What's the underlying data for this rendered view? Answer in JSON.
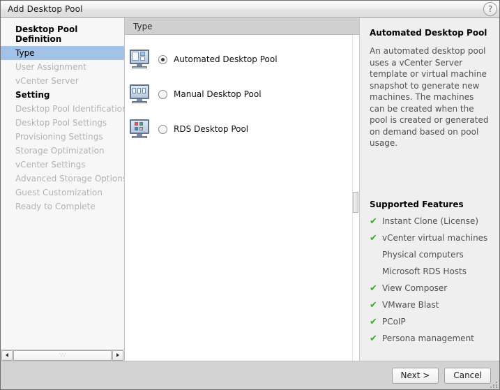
{
  "window": {
    "title": "Add Desktop Pool",
    "help_icon": "?"
  },
  "sidebar": {
    "groups": [
      {
        "label": "Desktop Pool Definition",
        "items": [
          {
            "label": "Type",
            "state": "active"
          },
          {
            "label": "User Assignment",
            "state": "disabled"
          },
          {
            "label": "vCenter Server",
            "state": "disabled"
          }
        ]
      },
      {
        "label": "Setting",
        "items": [
          {
            "label": "Desktop Pool Identification",
            "state": "disabled"
          },
          {
            "label": "Desktop Pool Settings",
            "state": "disabled"
          },
          {
            "label": "Provisioning Settings",
            "state": "disabled"
          },
          {
            "label": "Storage Optimization",
            "state": "disabled"
          },
          {
            "label": "vCenter Settings",
            "state": "disabled"
          },
          {
            "label": "Advanced Storage Options",
            "state": "disabled"
          },
          {
            "label": "Guest Customization",
            "state": "disabled"
          },
          {
            "label": "Ready to Complete",
            "state": "disabled"
          }
        ]
      }
    ]
  },
  "main": {
    "section_title": "Type",
    "options": [
      {
        "label": "Automated Desktop Pool",
        "selected": true,
        "icon": "automated-desktop-pool-icon"
      },
      {
        "label": "Manual Desktop Pool",
        "selected": false,
        "icon": "manual-desktop-pool-icon"
      },
      {
        "label": "RDS Desktop Pool",
        "selected": false,
        "icon": "rds-desktop-pool-icon"
      }
    ]
  },
  "info": {
    "title": "Automated Desktop Pool",
    "description": "An automated desktop pool uses a vCenter Server template or virtual machine snapshot to generate new machines. The machines can be created when the pool is created or generated on demand based on pool usage.",
    "features_title": "Supported Features",
    "features": [
      {
        "label": "Instant Clone (License)",
        "supported": true
      },
      {
        "label": "vCenter virtual machines",
        "supported": true
      },
      {
        "label": "Physical computers",
        "supported": false
      },
      {
        "label": "Microsoft RDS Hosts",
        "supported": false
      },
      {
        "label": "View Composer",
        "supported": true
      },
      {
        "label": "VMware Blast",
        "supported": true
      },
      {
        "label": "PCoIP",
        "supported": true
      },
      {
        "label": "Persona management",
        "supported": true
      }
    ],
    "check_glyph": "✔"
  },
  "footer": {
    "next_label": "Next >",
    "cancel_label": "Cancel"
  },
  "colors": {
    "accent_selection": "#a3c2e8",
    "check_green": "#3aa82a",
    "header_gray": "#d0d0d0",
    "info_bg": "#efefef"
  }
}
